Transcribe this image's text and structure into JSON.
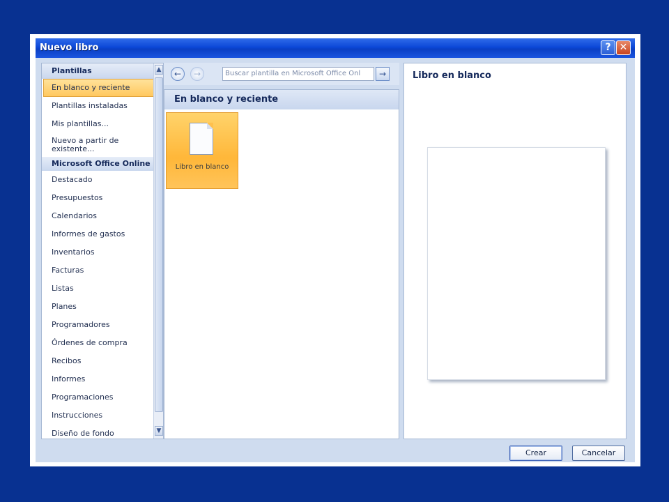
{
  "dialog": {
    "title": "Nuevo libro",
    "help_glyph": "?",
    "close_glyph": "✕"
  },
  "sidebar": {
    "section_templates": "Plantillas",
    "selected": "En blanco y reciente",
    "installed": "Plantillas instaladas",
    "my_templates": "Mis plantillas...",
    "from_existing": "Nuevo a partir de existente...",
    "section_online": "Microsoft Office Online",
    "online_items": [
      "Destacado",
      "Presupuestos",
      "Calendarios",
      "Informes de gastos",
      "Inventarios",
      "Facturas",
      "Listas",
      "Planes",
      "Programadores",
      "Órdenes de compra",
      "Recibos",
      "Informes",
      "Programaciones",
      "Instrucciones",
      "Diseño de fondo"
    ]
  },
  "navbar": {
    "back_glyph": "←",
    "forward_glyph": "→",
    "search_placeholder": "Buscar plantilla en Microsoft Office Onl",
    "go_glyph": "→"
  },
  "templates": {
    "header": "En blanco y reciente",
    "tile_label": "Libro en blanco"
  },
  "preview": {
    "title": "Libro en blanco"
  },
  "buttons": {
    "create": "Crear",
    "cancel": "Cancelar"
  },
  "colors": {
    "background": "#083191",
    "titlebar": "#0c48d8",
    "selection": "#ffc85f"
  }
}
